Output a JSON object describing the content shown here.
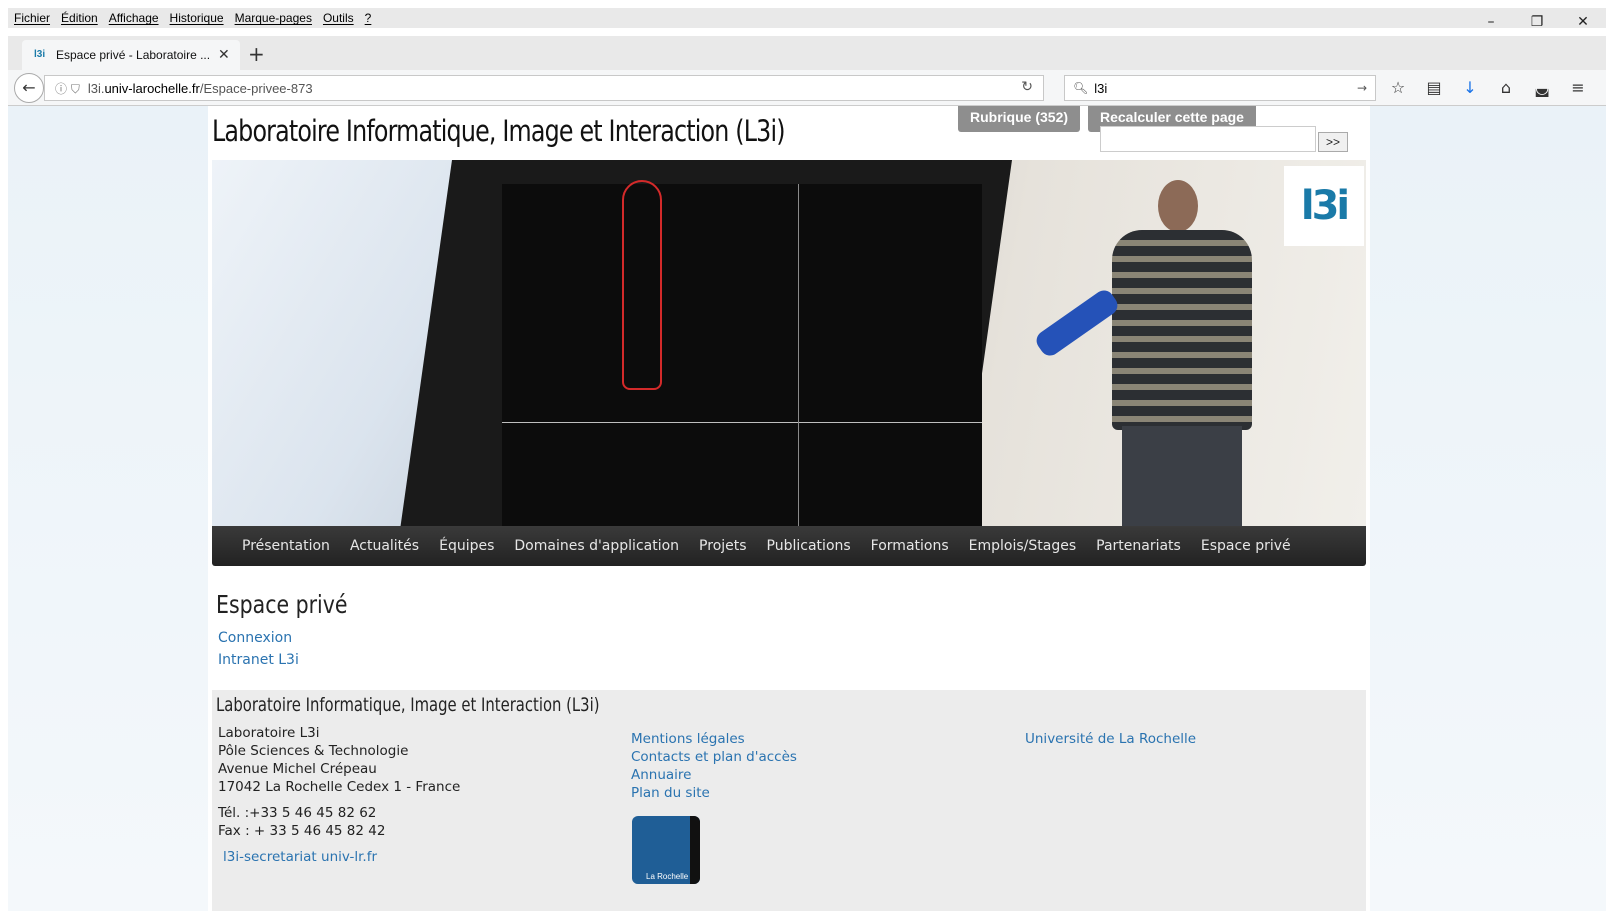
{
  "menubar": {
    "items": [
      "Fichier",
      "Édition",
      "Affichage",
      "Historique",
      "Marque-pages",
      "Outils",
      "?"
    ]
  },
  "window_controls": [
    "–",
    "❐",
    "✕"
  ],
  "tab": {
    "title": "Espace privé - Laboratoire ...",
    "favicon": "l3i"
  },
  "urlbar": {
    "prefix": "l3i.",
    "domain": "univ-larochelle.fr",
    "path": "/Espace-privee-873"
  },
  "searchbar": {
    "value": "l3i"
  },
  "site": {
    "title": "Laboratoire Informatique, Image et Interaction (L3i)",
    "admin_buttons": {
      "rubrique": "Rubrique (352)",
      "recalc": "Recalculer cette page"
    },
    "search_button": ">>",
    "logo": "l3i",
    "nav": [
      "Présentation",
      "Actualités",
      "Équipes",
      "Domaines d'application",
      "Projets",
      "Publications",
      "Formations",
      "Emplois/Stages",
      "Partenariats",
      "Espace privé"
    ],
    "content": {
      "title": "Espace privé",
      "links": [
        "Connexion",
        "Intranet L3i"
      ]
    },
    "footer": {
      "title": "Laboratoire Informatique, Image et Interaction (L3i)",
      "address": [
        "Laboratoire L3i",
        "Pôle Sciences & Technologie",
        "Avenue Michel Crépeau",
        "17042 La Rochelle Cedex 1 - France"
      ],
      "phone": "Tél. :+33 5 46 45 82 62",
      "fax": "Fax : + 33 5 46 45 82 42",
      "email": "l3i-secretariat univ-lr.fr",
      "links_col2": [
        "Mentions légales",
        "Contacts et plan d'accès",
        "Annuaire",
        "Plan du site"
      ],
      "links_col3": [
        "Université de La Rochelle"
      ],
      "univ_logo_text": "La Rochelle"
    }
  },
  "colors": {
    "link": "#2a73b0",
    "nav_bg": "#2b2b2b",
    "brand": "#1a7aa8"
  }
}
